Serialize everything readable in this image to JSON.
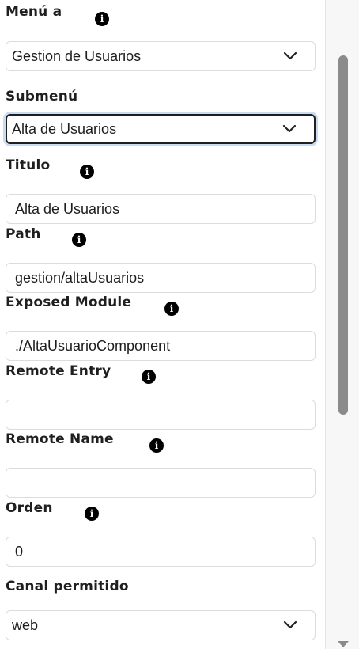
{
  "form": {
    "menu": {
      "label": "Menú a",
      "value": "Gestion de Usuarios",
      "icon": "info-icon"
    },
    "submenu": {
      "label": "Submenú",
      "value": "Alta de Usuarios"
    },
    "titulo": {
      "label": "Titulo",
      "value": "Alta de Usuarios",
      "icon": "info-icon"
    },
    "path": {
      "label": "Path",
      "value": "gestion/altaUsuarios",
      "icon": "info-icon"
    },
    "exposed_module": {
      "label": "Exposed Module",
      "value": "./AltaUsuarioComponent",
      "icon": "info-icon"
    },
    "remote_entry": {
      "label": "Remote Entry",
      "value": "",
      "icon": "info-icon"
    },
    "remote_name": {
      "label": "Remote Name",
      "value": "",
      "icon": "info-icon"
    },
    "orden": {
      "label": "Orden",
      "value": "0",
      "icon": "info-icon"
    },
    "canal": {
      "label": "Canal permitido",
      "value": "web"
    }
  },
  "info_glyph": "i",
  "colors": {
    "focus_ring": "#c9dcf3",
    "border": "#dcdcdc",
    "scroll_thumb": "#8b8b8b"
  }
}
